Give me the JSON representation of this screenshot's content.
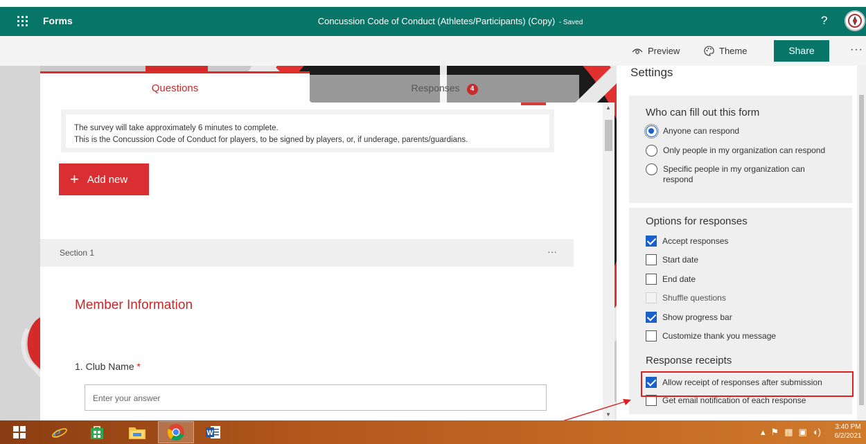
{
  "header": {
    "app_name": "Forms",
    "doc_title": "Concussion Code of Conduct (Athletes/Participants) (Copy)",
    "doc_status": "- Saved",
    "help": "?"
  },
  "toolbar": {
    "preview_label": "Preview",
    "theme_label": "Theme",
    "share_label": "Share",
    "more_label": "···"
  },
  "tabs": {
    "questions": "Questions",
    "responses": "Responses",
    "responses_count": "4"
  },
  "form": {
    "description_line1": "The survey will take approximately 6 minutes to complete.",
    "description_line2": "This is the Concussion Code of Conduct for players, to be signed by players, or, if underage, parents/guardians.",
    "add_new_label": "Add new",
    "section_label": "Section 1",
    "section_more": "···",
    "section_title": "Member Information",
    "question1_number": "1.",
    "question1_text": "Club Name",
    "question1_required": "*",
    "question1_placeholder": "Enter your answer"
  },
  "settings": {
    "title": "Settings",
    "who": {
      "heading": "Who can fill out this form",
      "options": [
        {
          "label": "Anyone can respond",
          "selected": true
        },
        {
          "label": "Only people in my organization can respond",
          "selected": false
        },
        {
          "label": "Specific people in my organization can respond",
          "selected": false
        }
      ]
    },
    "responses": {
      "heading": "Options for responses",
      "options": [
        {
          "label": "Accept responses",
          "checked": true,
          "enabled": true
        },
        {
          "label": "Start date",
          "checked": false,
          "enabled": true
        },
        {
          "label": "End date",
          "checked": false,
          "enabled": true
        },
        {
          "label": "Shuffle questions",
          "checked": false,
          "enabled": false
        },
        {
          "label": "Show progress bar",
          "checked": true,
          "enabled": true
        },
        {
          "label": "Customize thank you message",
          "checked": false,
          "enabled": true
        }
      ]
    },
    "receipts": {
      "heading": "Response receipts",
      "options": [
        {
          "label": "Allow receipt of responses after submission",
          "checked": true
        },
        {
          "label": "Get email notification of each response",
          "checked": false
        }
      ]
    }
  },
  "taskbar": {
    "time": "3:40 PM",
    "date": "6/2/2021"
  },
  "colors": {
    "brand": "#077568",
    "accent_red": "#d92f33",
    "check_blue": "#1a60c9",
    "annotation_red": "#e02020"
  }
}
